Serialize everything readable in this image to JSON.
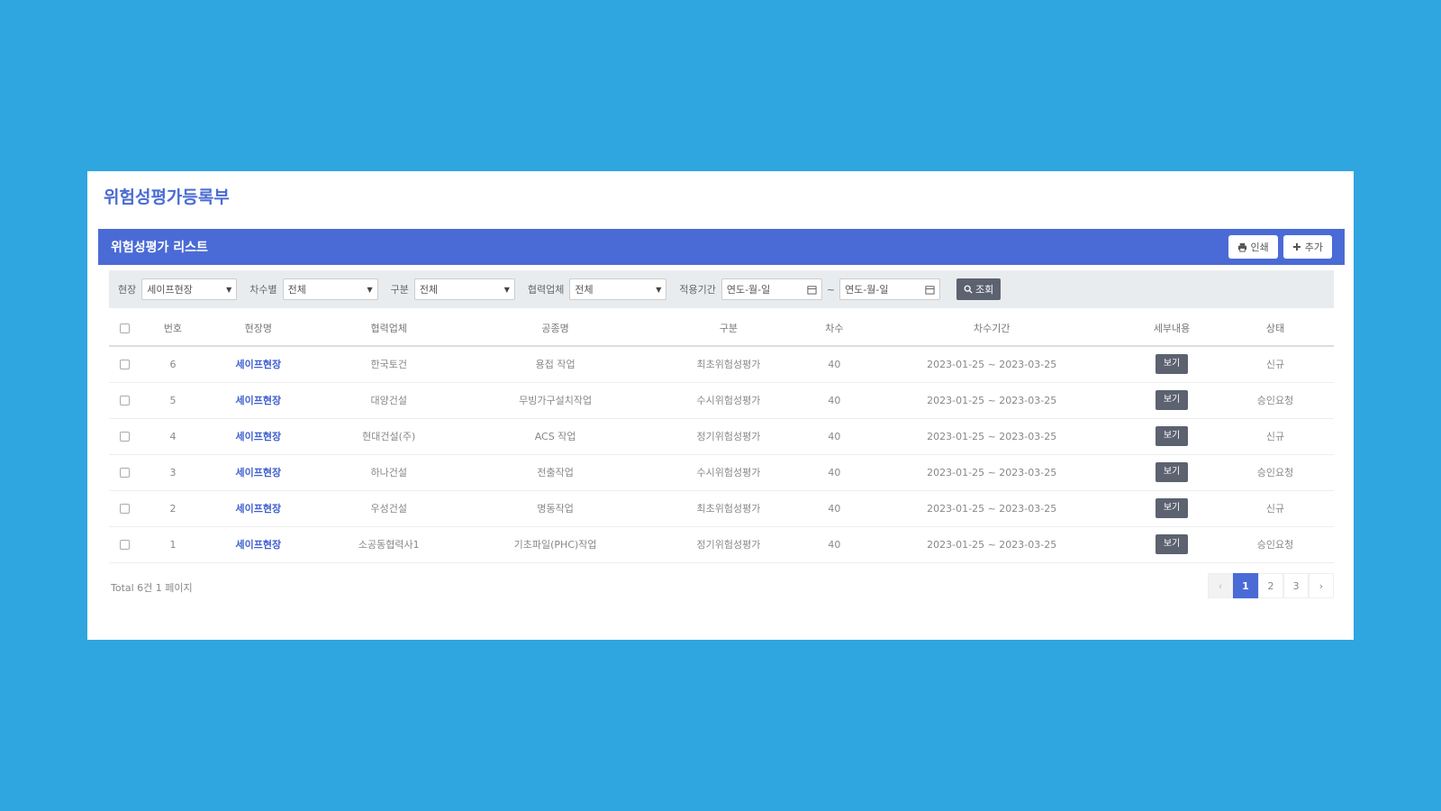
{
  "page": {
    "title": "위험성평가등록부"
  },
  "list": {
    "title": "위험성평가 리스트",
    "print_label": "인쇄",
    "add_label": "추가"
  },
  "filters": {
    "site_label": "현장",
    "site_value": "세이프현장",
    "round_label": "차수별",
    "round_value": "전체",
    "type_label": "구분",
    "type_value": "전체",
    "partner_label": "협력업체",
    "partner_value": "전체",
    "period_label": "적용기간",
    "date_from_placeholder": "연도-월-일",
    "date_to_placeholder": "연도-월-일",
    "date_sep": "~",
    "search_label": "조회"
  },
  "table": {
    "headers": {
      "no": "번호",
      "site": "현장명",
      "partner": "협력업체",
      "work": "공종명",
      "type": "구분",
      "round": "차수",
      "period": "차수기간",
      "detail": "세부내용",
      "status": "상태"
    },
    "rows": [
      {
        "no": "6",
        "site": "세이프현장",
        "partner": "한국토건",
        "work": "용접 작업",
        "type": "최초위험성평가",
        "round": "40",
        "period": "2023-01-25 ~ 2023-03-25",
        "detail": "보기",
        "status": "신규"
      },
      {
        "no": "5",
        "site": "세이프현장",
        "partner": "대양건설",
        "work": "무빙가구설치작업",
        "type": "수시위험성평가",
        "round": "40",
        "period": "2023-01-25 ~ 2023-03-25",
        "detail": "보기",
        "status": "승인요청"
      },
      {
        "no": "4",
        "site": "세이프현장",
        "partner": "현대건설(주)",
        "work": "ACS 작업",
        "type": "정기위험성평가",
        "round": "40",
        "period": "2023-01-25 ~ 2023-03-25",
        "detail": "보기",
        "status": "신규"
      },
      {
        "no": "3",
        "site": "세이프현장",
        "partner": "하나건설",
        "work": "전출작업",
        "type": "수시위험성평가",
        "round": "40",
        "period": "2023-01-25 ~ 2023-03-25",
        "detail": "보기",
        "status": "승인요청"
      },
      {
        "no": "2",
        "site": "세이프현장",
        "partner": "우성건설",
        "work": "명동작업",
        "type": "최초위험성평가",
        "round": "40",
        "period": "2023-01-25 ~ 2023-03-25",
        "detail": "보기",
        "status": "신규"
      },
      {
        "no": "1",
        "site": "세이프현장",
        "partner": "소공동협력사1",
        "work": "기초파일(PHC)작업",
        "type": "정기위험성평가",
        "round": "40",
        "period": "2023-01-25 ~ 2023-03-25",
        "detail": "보기",
        "status": "승인요청"
      }
    ]
  },
  "footer": {
    "total": "Total 6건 1 페이지"
  },
  "pagination": {
    "prev": "‹",
    "pages": [
      "1",
      "2",
      "3"
    ],
    "next": "›"
  },
  "colors": {
    "background": "#2fa6e0",
    "accent": "#4a6bd6",
    "button_dark": "#5c6270"
  },
  "icons": {
    "print": "printer-icon",
    "add": "plus-icon",
    "search": "search-icon",
    "calendar": "calendar-icon"
  }
}
